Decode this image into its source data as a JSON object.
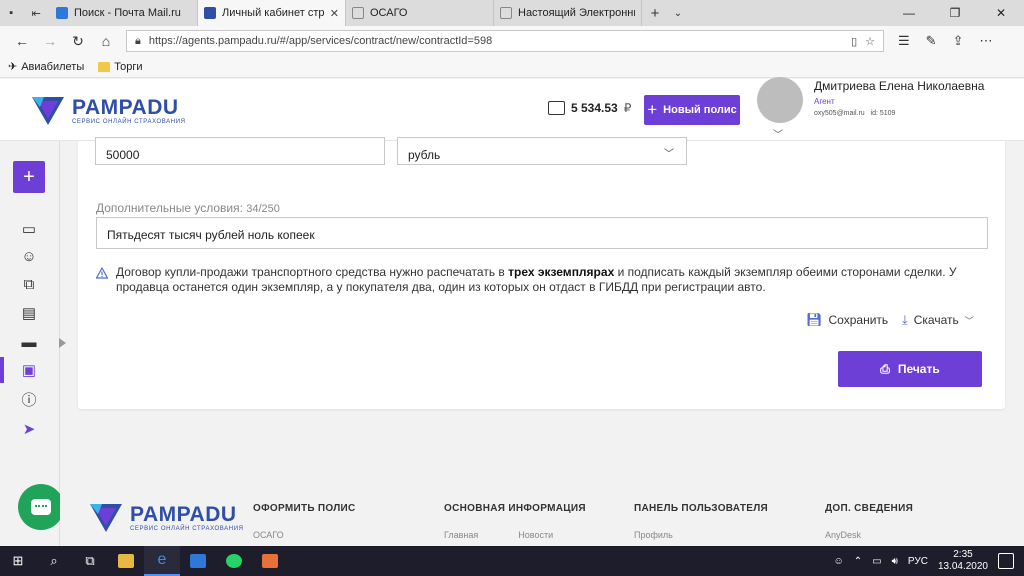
{
  "browser": {
    "tabs": [
      {
        "title": "Поиск - Почта Mail.ru",
        "color": "#2e78d8",
        "active": false
      },
      {
        "title": "Личный кабинет страх",
        "color": "#2f4fa7",
        "active": true
      },
      {
        "title": "ОСАГО",
        "color": "#888888",
        "active": false
      },
      {
        "title": "Настоящий Электронный",
        "color": "#888888",
        "active": false
      }
    ],
    "url": "https://agents.pampadu.ru/#/app/services/contract/new/contractId=598",
    "bookmarks": [
      "Авиабилеты",
      "Торги"
    ]
  },
  "header": {
    "logo_name": "PAMPADU",
    "logo_tagline": "Сервис онлайн страхования",
    "balance": "5 534.53",
    "currency_symbol": "₽",
    "new_policy_label": "Новый полис",
    "user_name": "Дмитриева Елена Николаевна",
    "user_role": "Агент",
    "user_email": "oxy505@mail.ru",
    "user_id": "id: 5109"
  },
  "form": {
    "amount_value": "50000",
    "currency_value": "рубль",
    "extra_label": "Дополнительные условия:",
    "extra_counter": "34/250",
    "extra_value": "Пятьдесят тысяч рублей ноль копеек",
    "warning_before": "Договор купли-продажи транспортного средства нужно распечатать в ",
    "warning_bold": "трех экземплярах",
    "warning_after": " и подписать каждый экземпляр обеими сторонами сделки. У продавца останется один экземпляр, а у покупателя два, один из которых он отдаст в ГИБДД при регистрации авто.",
    "save_label": "Сохранить",
    "download_label": "Скачать",
    "print_label": "Печать"
  },
  "footer": {
    "col1_title": "ОФОРМИТЬ ПОЛИС",
    "col1_links": [
      "ОСАГО"
    ],
    "col2_title": "ОСНОВНАЯ ИНФОРМАЦИЯ",
    "col2_links": [
      "Главная",
      "Новости"
    ],
    "col3_title": "ПАНЕЛЬ ПОЛЬЗОВАТЕЛЯ",
    "col3_links": [
      "Профиль"
    ],
    "col4_title": "ДОП. СВЕДЕНИЯ",
    "col4_links": [
      "AnyDesk"
    ]
  },
  "taskbar": {
    "lang": "РУС",
    "time": "2:35",
    "date": "13.04.2020"
  },
  "colors": {
    "accent": "#6e3fd6",
    "brand": "#2f4fa7",
    "chat": "#1fa45a"
  }
}
